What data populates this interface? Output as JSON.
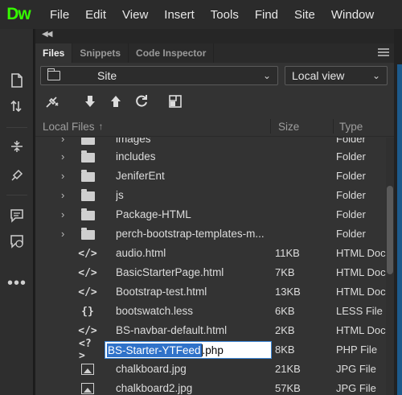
{
  "app": {
    "logo_text": "Dw",
    "logo_color": "#35fa00"
  },
  "menu": [
    "File",
    "Edit",
    "View",
    "Insert",
    "Tools",
    "Find",
    "Site",
    "Window"
  ],
  "panel": {
    "tabs": [
      {
        "label": "Files",
        "active": true
      },
      {
        "label": "Snippets",
        "active": false
      },
      {
        "label": "Code Inspector",
        "active": false
      }
    ],
    "site_select": {
      "value": "Site"
    },
    "view_select": {
      "value": "Local view"
    },
    "header": {
      "name": "Local Files",
      "size": "Size",
      "type": "Type"
    }
  },
  "files": [
    {
      "name": "images",
      "size": "",
      "type": "Folder",
      "kind": "folder"
    },
    {
      "name": "includes",
      "size": "",
      "type": "Folder",
      "kind": "folder"
    },
    {
      "name": "JeniferEnt",
      "size": "",
      "type": "Folder",
      "kind": "folder"
    },
    {
      "name": "js",
      "size": "",
      "type": "Folder",
      "kind": "folder"
    },
    {
      "name": "Package-HTML",
      "size": "",
      "type": "Folder",
      "kind": "folder"
    },
    {
      "name": "perch-bootstrap-templates-m...",
      "size": "",
      "type": "Folder",
      "kind": "folder"
    },
    {
      "name": "audio.html",
      "size": "11KB",
      "type": "HTML Doc",
      "kind": "code"
    },
    {
      "name": "BasicStarterPage.html",
      "size": "7KB",
      "type": "HTML Doc",
      "kind": "code"
    },
    {
      "name": "Bootstrap-test.html",
      "size": "13KB",
      "type": "HTML Doc",
      "kind": "code"
    },
    {
      "name": "bootswatch.less",
      "size": "6KB",
      "type": "LESS File",
      "kind": "braces"
    },
    {
      "name": "BS-navbar-default.html",
      "size": "2KB",
      "type": "HTML Doc",
      "kind": "code"
    },
    {
      "name": "BS-Starter-YTFeed.php",
      "size": "8KB",
      "type": "PHP File",
      "kind": "php",
      "rename": {
        "selected": "BS-Starter-YTFeed",
        "rest": ".php"
      }
    },
    {
      "name": "chalkboard.jpg",
      "size": "21KB",
      "type": "JPG File",
      "kind": "image"
    },
    {
      "name": "chalkboard2.jpg",
      "size": "57KB",
      "type": "JPG File",
      "kind": "image"
    }
  ]
}
